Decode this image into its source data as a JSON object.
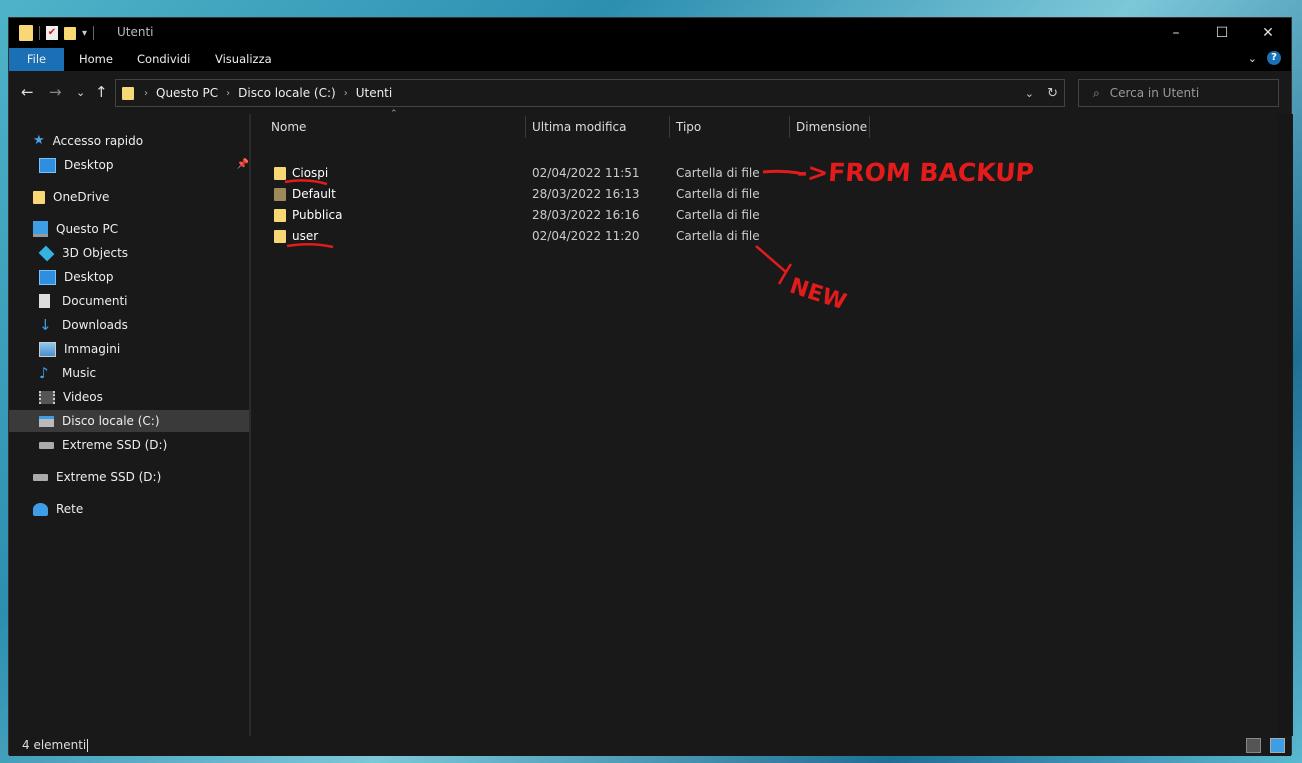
{
  "window": {
    "title": "Utenti",
    "controls": {
      "minimize": "–",
      "maximize": "☐",
      "close": "✕"
    }
  },
  "ribbon": {
    "tabs": [
      "File",
      "Home",
      "Condividi",
      "Visualizza"
    ]
  },
  "navigation": {
    "breadcrumb": [
      "Questo PC",
      "Disco locale (C:)",
      "Utenti"
    ],
    "search_placeholder": "Cerca in Utenti"
  },
  "sidebar": {
    "items": [
      {
        "label": "Accesso rapido",
        "icon": "star-icon"
      },
      {
        "label": "Desktop",
        "icon": "desktop-icon",
        "pinned": true
      },
      {
        "label": "OneDrive",
        "icon": "folder-icon"
      },
      {
        "label": "Questo PC",
        "icon": "pc-icon"
      },
      {
        "label": "3D Objects",
        "icon": "cube-icon"
      },
      {
        "label": "Desktop",
        "icon": "desktop-icon"
      },
      {
        "label": "Documenti",
        "icon": "document-icon"
      },
      {
        "label": "Downloads",
        "icon": "download-icon"
      },
      {
        "label": "Immagini",
        "icon": "image-icon"
      },
      {
        "label": "Music",
        "icon": "music-icon"
      },
      {
        "label": "Videos",
        "icon": "video-icon"
      },
      {
        "label": "Disco locale (C:)",
        "icon": "drive-icon",
        "selected": true
      },
      {
        "label": "Extreme SSD (D:)",
        "icon": "usb-drive-icon"
      },
      {
        "label": "Extreme SSD (D:)",
        "icon": "usb-drive-icon"
      },
      {
        "label": "Rete",
        "icon": "network-icon"
      }
    ]
  },
  "file_list": {
    "columns": [
      "Nome",
      "Ultima modifica",
      "Tipo",
      "Dimensione"
    ],
    "rows": [
      {
        "name": "Ciospi",
        "modified": "02/04/2022 11:51",
        "type": "Cartella di file",
        "size": ""
      },
      {
        "name": "Default",
        "modified": "28/03/2022 16:13",
        "type": "Cartella di file",
        "size": ""
      },
      {
        "name": "Pubblica",
        "modified": "28/03/2022 16:16",
        "type": "Cartella di file",
        "size": ""
      },
      {
        "name": "user",
        "modified": "02/04/2022 11:20",
        "type": "Cartella di file",
        "size": ""
      }
    ]
  },
  "status": {
    "count": "4 elementi"
  },
  "annotations": {
    "from_backup": "->FROM BACKUP",
    "new": "NEW"
  },
  "colors": {
    "accent": "#1a6fb5",
    "folder": "#f8d775",
    "annotation": "#e31b1b"
  }
}
